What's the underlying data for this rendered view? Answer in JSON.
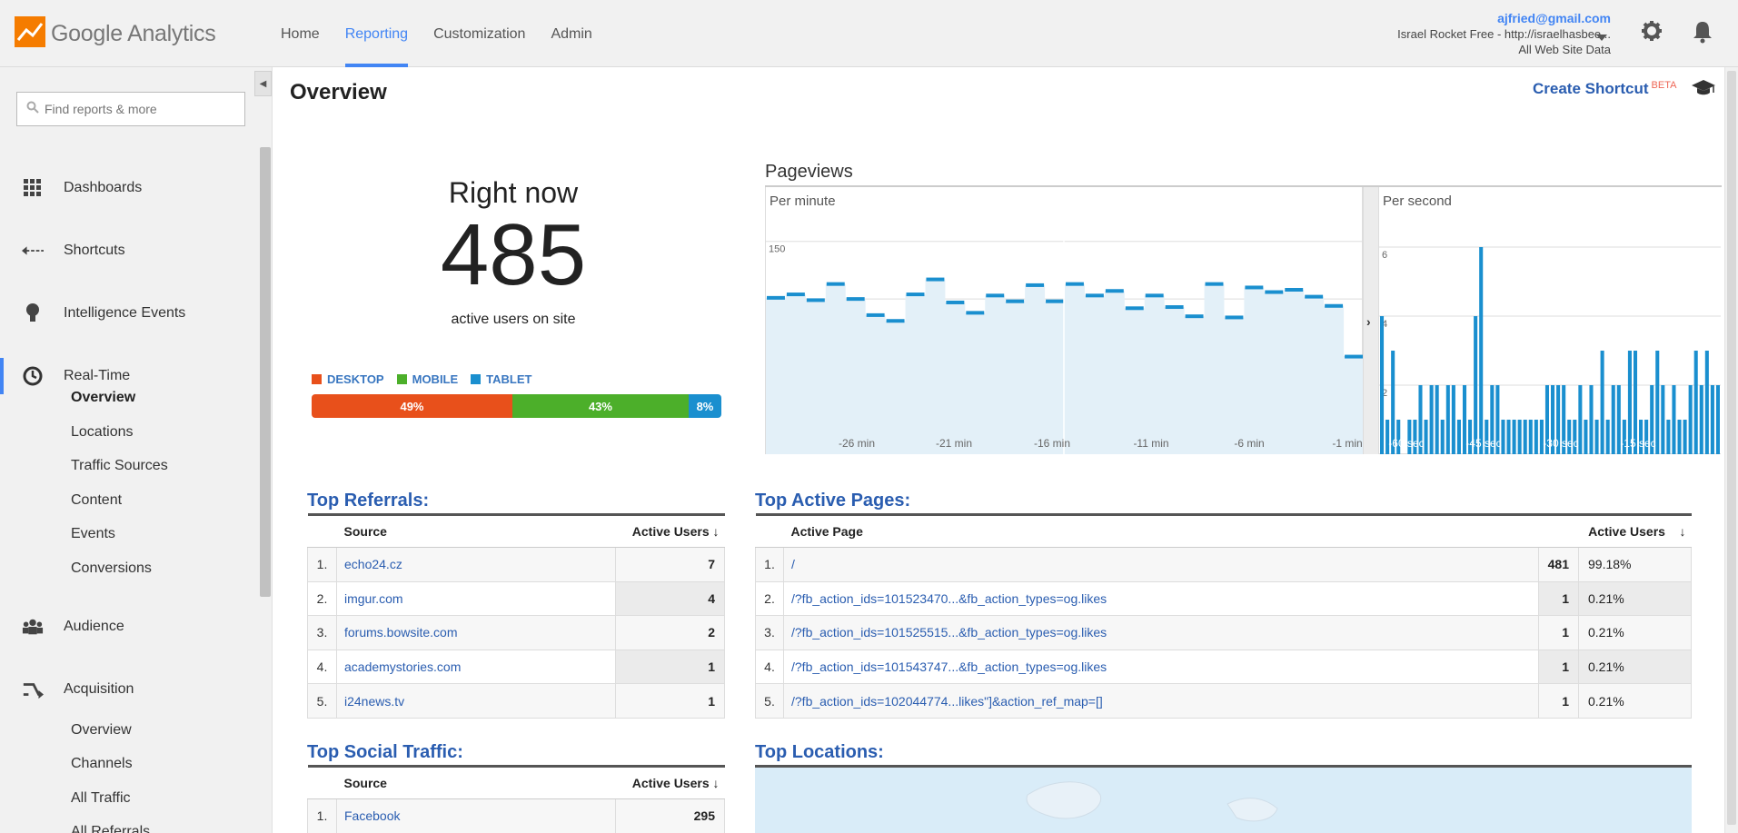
{
  "app": {
    "logo_text": "Google Analytics"
  },
  "nav": {
    "items": [
      "Home",
      "Reporting",
      "Customization",
      "Admin"
    ],
    "active": "Reporting"
  },
  "account": {
    "email": "ajfried@gmail.com",
    "property": "Israel Rocket Free - http://israelhasbee...",
    "view": "All Web Site Data"
  },
  "sidebar": {
    "search_placeholder": "Find reports & more",
    "main_items": [
      "Dashboards",
      "Shortcuts",
      "Intelligence Events",
      "Real-Time",
      "Audience",
      "Acquisition"
    ],
    "realtime_sub": [
      "Overview",
      "Locations",
      "Traffic Sources",
      "Content",
      "Events",
      "Conversions"
    ],
    "acquisition_sub": [
      "Overview",
      "Channels",
      "All Traffic",
      "All Referrals"
    ]
  },
  "page": {
    "title": "Overview",
    "shortcut_label": "Create Shortcut",
    "beta_label": "BETA"
  },
  "right_now": {
    "title": "Right now",
    "value": "485",
    "subtitle": "active users on site",
    "legend": [
      {
        "label": "DESKTOP",
        "color": "#e8501b"
      },
      {
        "label": "MOBILE",
        "color": "#4caf2a"
      },
      {
        "label": "TABLET",
        "color": "#1a8fcf"
      }
    ],
    "segments": [
      {
        "label": "49%",
        "value": 49,
        "color": "#e8501b"
      },
      {
        "label": "43%",
        "value": 43,
        "color": "#4caf2a"
      },
      {
        "label": "8%",
        "value": 8,
        "color": "#1a8fcf"
      }
    ]
  },
  "pageviews": {
    "title": "Pageviews",
    "per_minute_label": "Per minute",
    "per_second_label": "Per second"
  },
  "chart_data": [
    {
      "type": "area",
      "title": "Per minute",
      "ylim": [
        0,
        175
      ],
      "yticks": [
        50,
        100,
        150
      ],
      "xtick_labels": [
        "-26 min",
        "-21 min",
        "-16 min",
        "-11 min",
        "-6 min",
        "-1 min"
      ],
      "values": [
        101,
        104,
        99,
        113,
        100,
        86,
        81,
        104,
        117,
        97,
        88,
        103,
        98,
        112,
        98,
        113,
        103,
        107,
        92,
        103,
        93,
        85,
        113,
        84,
        110,
        106,
        108,
        102,
        94,
        50
      ]
    },
    {
      "type": "bar",
      "title": "Per second",
      "ylim": [
        0,
        7
      ],
      "yticks": [
        2,
        4,
        6
      ],
      "xtick_labels": [
        "-60 sec",
        "-45 sec",
        "-30 sec",
        "-15 sec"
      ],
      "values": [
        4,
        1,
        3,
        1,
        0,
        1,
        1,
        2,
        1,
        2,
        2,
        1,
        2,
        2,
        1,
        2,
        1,
        4,
        6,
        1,
        2,
        2,
        1,
        1,
        1,
        1,
        1,
        1,
        1,
        1,
        2,
        2,
        2,
        2,
        1,
        1,
        2,
        1,
        2,
        1,
        3,
        1,
        2,
        2,
        1,
        3,
        3,
        1,
        1,
        2,
        3,
        2,
        1,
        2,
        1,
        1,
        2,
        3,
        2,
        3,
        2,
        2
      ]
    }
  ],
  "top_referrals": {
    "title": "Top Referrals:",
    "col_source": "Source",
    "col_users": "Active Users",
    "sort_icon": "↓",
    "rows": [
      {
        "n": "1.",
        "source": "echo24.cz",
        "users": "7"
      },
      {
        "n": "2.",
        "source": "imgur.com",
        "users": "4"
      },
      {
        "n": "3.",
        "source": "forums.bowsite.com",
        "users": "2"
      },
      {
        "n": "4.",
        "source": "academystories.com",
        "users": "1"
      },
      {
        "n": "5.",
        "source": "i24news.tv",
        "users": "1"
      }
    ]
  },
  "top_pages": {
    "title": "Top Active Pages:",
    "col_page": "Active Page",
    "col_users": "Active Users",
    "sort_icon": "↓",
    "rows": [
      {
        "n": "1.",
        "page": "/",
        "users": "481",
        "pct": "99.18%"
      },
      {
        "n": "2.",
        "page": "/?fb_action_ids=101523470...&fb_action_types=og.likes",
        "users": "1",
        "pct": "0.21%"
      },
      {
        "n": "3.",
        "page": "/?fb_action_ids=101525515...&fb_action_types=og.likes",
        "users": "1",
        "pct": "0.21%"
      },
      {
        "n": "4.",
        "page": "/?fb_action_ids=101543747...&fb_action_types=og.likes",
        "users": "1",
        "pct": "0.21%"
      },
      {
        "n": "5.",
        "page": "/?fb_action_ids=102044774...likes\"]&action_ref_map=[]",
        "users": "1",
        "pct": "0.21%"
      }
    ]
  },
  "top_social": {
    "title": "Top Social Traffic:",
    "col_source": "Source",
    "col_users": "Active Users",
    "sort_icon": "↓",
    "rows": [
      {
        "n": "1.",
        "source": "Facebook",
        "users": "295"
      }
    ]
  },
  "top_locations": {
    "title": "Top Locations:"
  }
}
